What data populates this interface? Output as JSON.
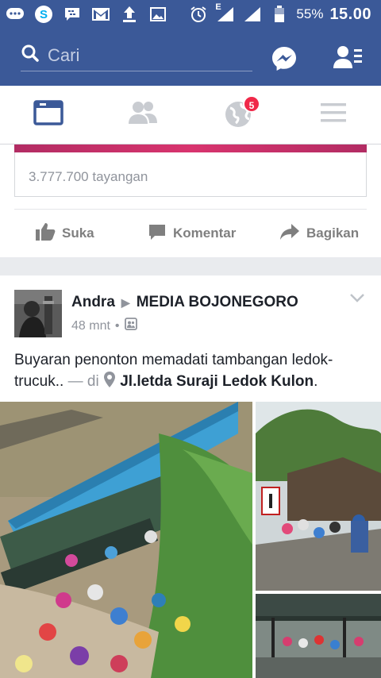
{
  "status_bar": {
    "battery": "55%",
    "time": "15.00",
    "network": "E"
  },
  "search": {
    "placeholder": "Cari"
  },
  "tabs": {
    "notifications_badge": "5"
  },
  "previous_post": {
    "views": "3.777.700 tayangan",
    "like_label": "Suka",
    "comment_label": "Komentar",
    "share_label": "Bagikan"
  },
  "post": {
    "author": "Andra",
    "arrow": "▶",
    "page": "MEDIA BOJONEGORO",
    "time": "48 mnt",
    "dot": "•",
    "text": "Buyaran penonton memadati tambangan ledok-trucuk..",
    "location_prefix": "— di",
    "location": "Jl.letda Suraji Ledok Kulon",
    "period": "."
  },
  "colors": {
    "brand": "#3b5998",
    "badge": "#f02849",
    "active_tab": "#3b5998",
    "inactive_tab": "#c9ccd1"
  }
}
